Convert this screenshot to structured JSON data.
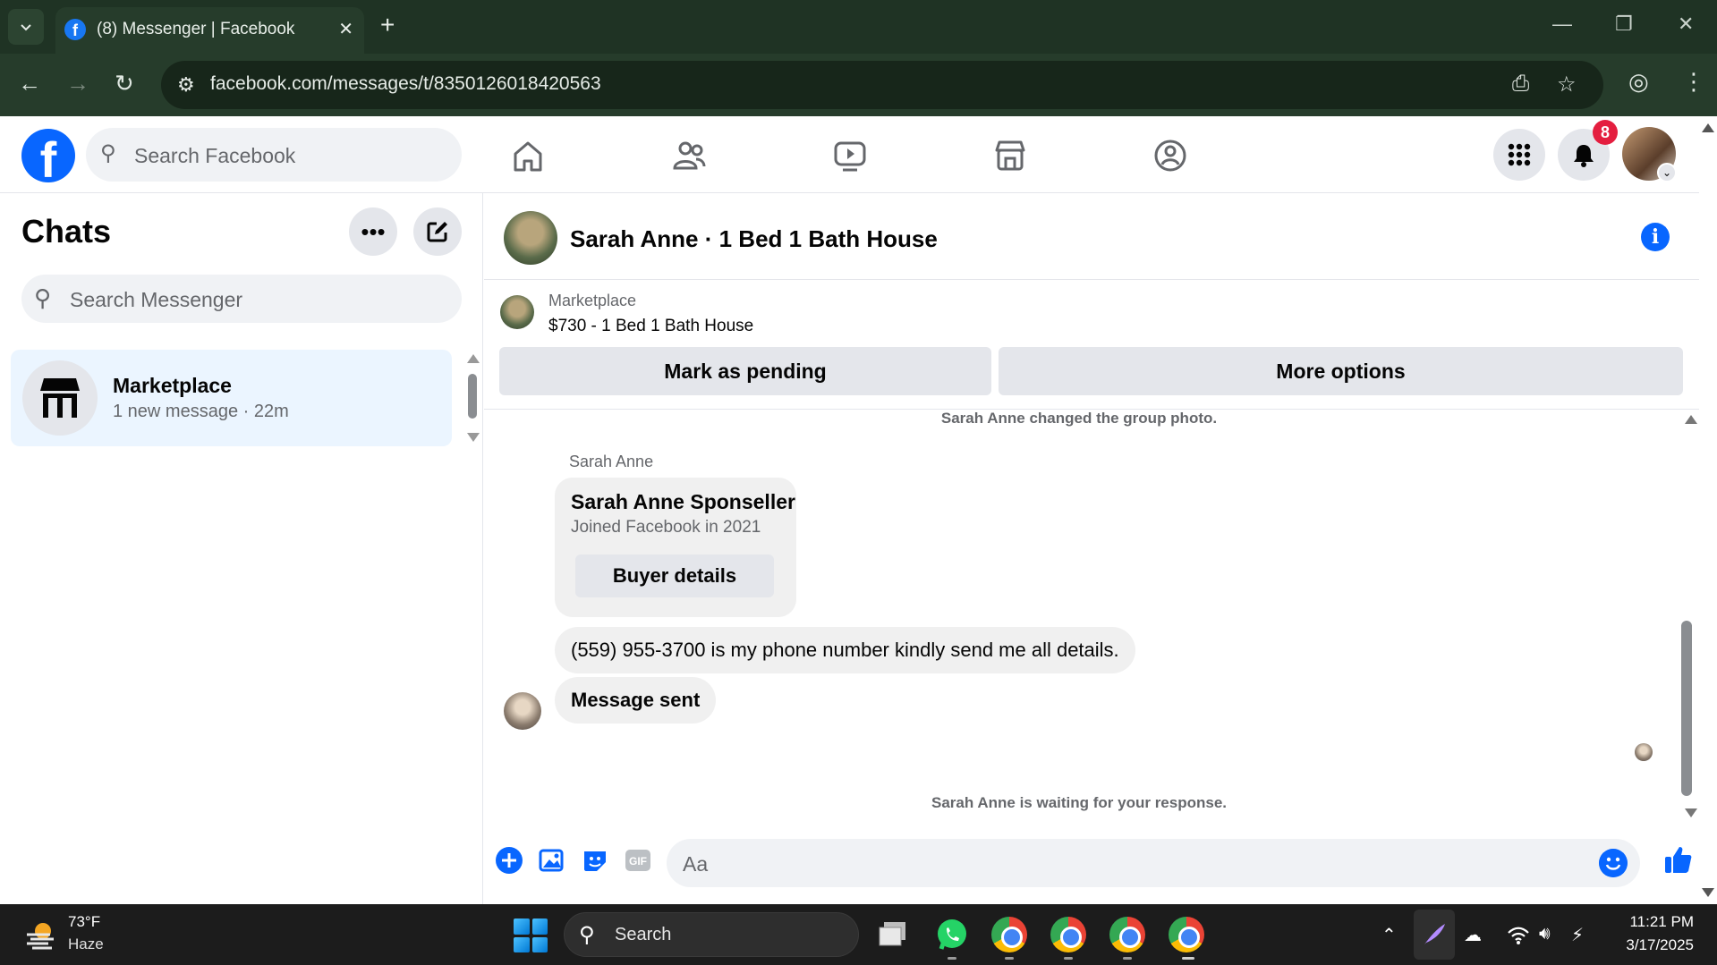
{
  "browser": {
    "tab_title": "(8) Messenger | Facebook",
    "url": "facebook.com/messages/t/8350126018420563"
  },
  "fb_header": {
    "search_placeholder": "Search Facebook",
    "notification_count": "8"
  },
  "chats_panel": {
    "title": "Chats",
    "search_placeholder": "Search Messenger",
    "items": [
      {
        "name": "Marketplace",
        "preview": "1 new message · 22m"
      }
    ]
  },
  "conversation": {
    "title": "Sarah Anne · 1 Bed 1 Bath House",
    "listing": {
      "label": "Marketplace",
      "price_title": "$730 - 1 Bed 1 Bath House",
      "mark_pending_label": "Mark as pending",
      "more_options_label": "More options"
    },
    "system_message_top": "Sarah Anne changed the group photo.",
    "sender_name": "Sarah Anne",
    "buyer_card": {
      "name": "Sarah Anne Sponseller",
      "joined": "Joined Facebook in 2021",
      "button_label": "Buyer details"
    },
    "messages": [
      "(559) 955-3700 is my phone number kindly send me all details.",
      "Message sent"
    ],
    "waiting_text": "Sarah Anne is waiting for your response.",
    "composer_placeholder": "Aa"
  },
  "taskbar": {
    "temperature": "73°F",
    "weather": "Haze",
    "search_placeholder": "Search",
    "time": "11:21 PM",
    "date": "3/17/2025"
  },
  "colors": {
    "fb_blue": "#0866ff",
    "chrome_frame": "#1f3324",
    "selected_chat": "#ebf5ff",
    "badge_red": "#e41e3f"
  }
}
